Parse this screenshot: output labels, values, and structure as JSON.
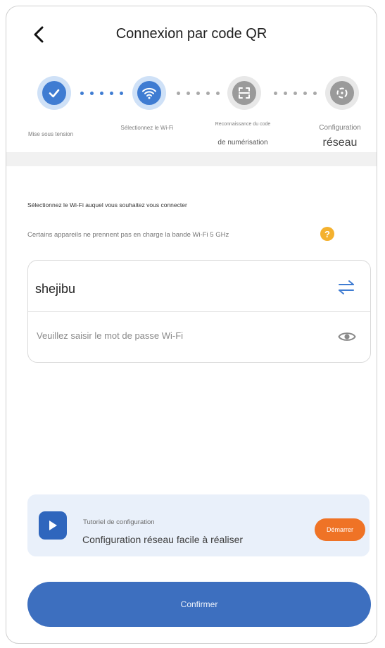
{
  "header": {
    "title": "Connexion par code QR",
    "back_icon": "chevron-left-icon"
  },
  "steps": [
    {
      "label": "Mise sous tension",
      "state": "done",
      "icon": "check-icon"
    },
    {
      "label": "Sélectionnez le Wi-Fi",
      "state": "active",
      "icon": "wifi-icon"
    },
    {
      "label_line1": "Reconnaissance du code",
      "label_line2": "de numérisation",
      "state": "pending",
      "icon": "scan-icon"
    },
    {
      "label_line1": "Configuration",
      "label_line2": "réseau",
      "state": "pending",
      "icon": "network-config-icon"
    }
  ],
  "wifi": {
    "instruction": "Sélectionnez le Wi-Fi auquel vous souhaitez vous connecter",
    "note": "Certains appareils ne prennent pas en charge la bande Wi-Fi 5 GHz",
    "help_icon": "question-icon",
    "ssid": "shejibu",
    "password_placeholder": "Veuillez saisir le mot de passe Wi-Fi",
    "password_value": ""
  },
  "tutorial": {
    "small_label": "Tutoriel de configuration",
    "main_label": "Configuration réseau facile à réaliser",
    "button_label": "Démarrer"
  },
  "confirm_label": "Confirmer",
  "colors": {
    "primary": "#3d6fbf",
    "accent_orange": "#ef7326",
    "help_yellow": "#f4b12e",
    "inactive_grey": "#9a9a9a"
  }
}
